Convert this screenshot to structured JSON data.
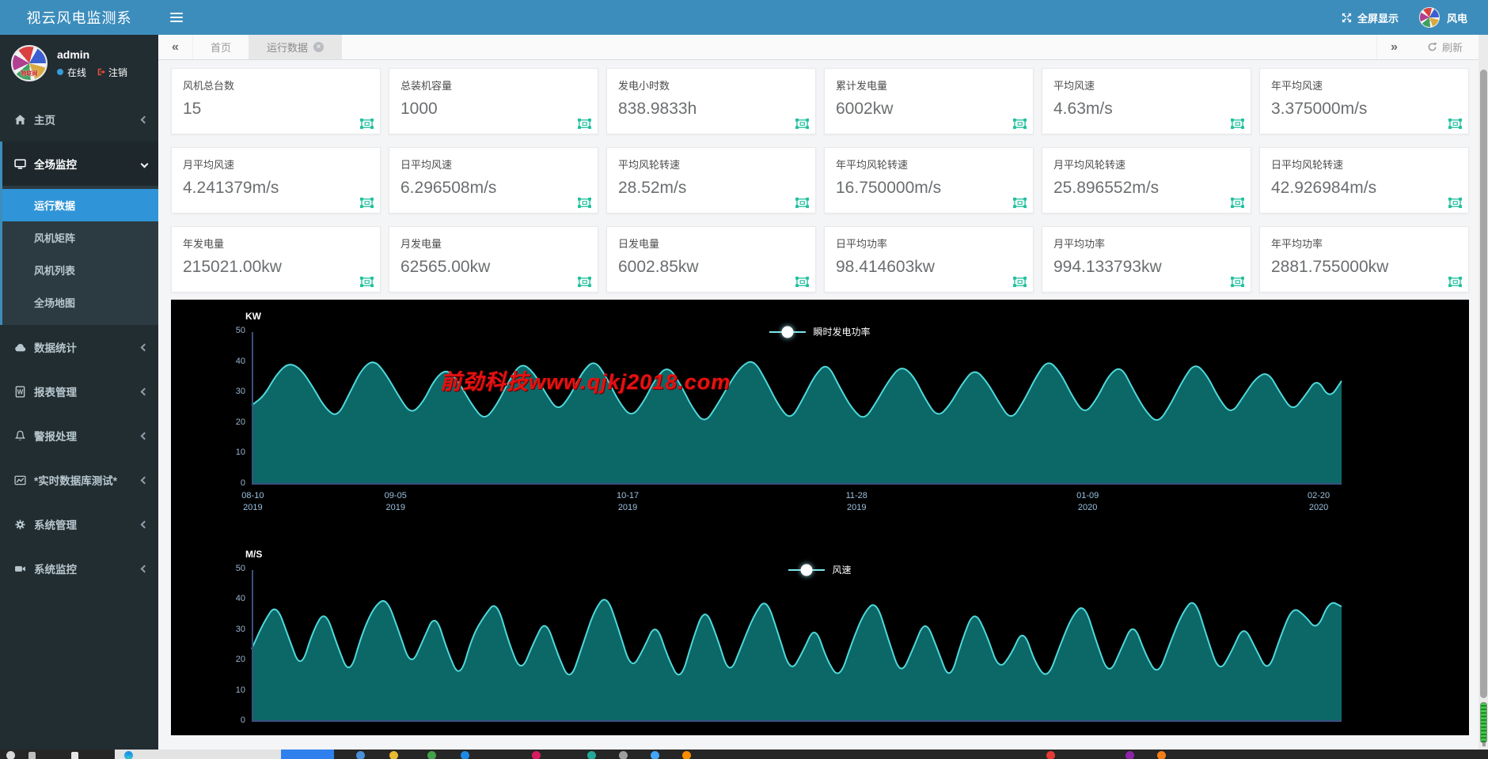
{
  "header": {
    "app_title": "视云风电监测系",
    "fullscreen_label": "全屏显示",
    "username": "风电"
  },
  "sidebar": {
    "user": {
      "name": "admin",
      "status": "在线",
      "logout": "注销",
      "avatar_text": "物联网"
    },
    "home": {
      "label": "主页",
      "icon": "home-icon"
    },
    "monitor_group": {
      "label": "全场监控",
      "icon": "monitor-icon"
    },
    "submenu": [
      {
        "label": "运行数据",
        "active": true
      },
      {
        "label": "风机矩阵"
      },
      {
        "label": "风机列表"
      },
      {
        "label": "全场地图"
      }
    ],
    "items": [
      {
        "label": "数据统计",
        "icon": "cloud-icon"
      },
      {
        "label": "报表管理",
        "icon": "report-icon"
      },
      {
        "label": "警报处理",
        "icon": "bell-icon"
      },
      {
        "label": "*实时数据库测试*",
        "icon": "chart-line-icon"
      },
      {
        "label": "系统管理",
        "icon": "gear-icon"
      },
      {
        "label": "系统监控",
        "icon": "camera-icon"
      }
    ]
  },
  "tabbar": {
    "tabs": [
      {
        "label": "首页"
      },
      {
        "label": "运行数据",
        "active": true,
        "closable": true
      }
    ],
    "refresh_label": "刷新"
  },
  "cards": [
    {
      "label": "风机总台数",
      "value": "15"
    },
    {
      "label": "总装机容量",
      "value": "1000"
    },
    {
      "label": "发电小时数",
      "value": "838.9833h"
    },
    {
      "label": "累计发电量",
      "value": "6002kw"
    },
    {
      "label": "平均风速",
      "value": "4.63m/s"
    },
    {
      "label": "年平均风速",
      "value": "3.375000m/s"
    },
    {
      "label": "月平均风速",
      "value": "4.241379m/s"
    },
    {
      "label": "日平均风速",
      "value": "6.296508m/s"
    },
    {
      "label": "平均风轮转速",
      "value": "28.52m/s"
    },
    {
      "label": "年平均风轮转速",
      "value": "16.750000m/s"
    },
    {
      "label": "月平均风轮转速",
      "value": "25.896552m/s"
    },
    {
      "label": "日平均风轮转速",
      "value": "42.926984m/s"
    },
    {
      "label": "年发电量",
      "value": "215021.00kw"
    },
    {
      "label": "月发电量",
      "value": "62565.00kw"
    },
    {
      "label": "日发电量",
      "value": "6002.85kw"
    },
    {
      "label": "日平均功率",
      "value": "98.414603kw"
    },
    {
      "label": "月平均功率",
      "value": "994.133793kw"
    },
    {
      "label": "年平均功率",
      "value": "2881.755000kw"
    }
  ],
  "watermark": "前劲科技www.qjkj2018.com",
  "colors": {
    "accent": "#3c8dbc",
    "chart_stroke": "#4fd9db",
    "chart_fill": "#0d6b6b",
    "axis": "#3a4f7e",
    "tick_text": "#9db4d0",
    "card_icon": "#1fbf9c",
    "watermark": "#e51111"
  },
  "chart_data": [
    {
      "type": "area",
      "unit": "KW",
      "legend": "瞬时发电功率",
      "ylim": [
        0,
        50
      ],
      "yticks": [
        50,
        40,
        30,
        20,
        10,
        0
      ],
      "grid": false,
      "legend_position": "top-center",
      "x_labels": [
        {
          "date": "08-10",
          "year": "2019",
          "pos": 0.001
        },
        {
          "date": "09-05",
          "year": "2019",
          "pos": 0.132
        },
        {
          "date": "10-17",
          "year": "2019",
          "pos": 0.345
        },
        {
          "date": "11-28",
          "year": "2019",
          "pos": 0.555
        },
        {
          "date": "01-09",
          "year": "2020",
          "pos": 0.767
        },
        {
          "date": "02-20",
          "year": "2020",
          "pos": 0.979
        }
      ],
      "values": [
        26,
        29,
        36,
        40,
        38,
        32,
        25,
        22,
        30,
        38,
        41,
        36,
        29,
        23,
        27,
        35,
        38,
        33,
        26,
        21,
        26,
        34,
        40,
        37,
        30,
        24,
        29,
        37,
        41,
        35,
        27,
        22,
        27,
        35,
        39,
        33,
        25,
        20,
        26,
        33,
        39,
        41,
        34,
        26,
        21,
        28,
        36,
        40,
        32,
        25,
        21,
        27,
        34,
        39,
        36,
        28,
        22,
        26,
        33,
        38,
        34,
        27,
        21,
        27,
        35,
        41,
        37,
        29,
        23,
        28,
        36,
        39,
        31,
        24,
        20,
        26,
        34,
        40,
        36,
        28,
        23,
        29,
        35,
        37,
        30,
        24,
        29,
        35,
        28,
        34
      ]
    },
    {
      "type": "area",
      "unit": "M/S",
      "legend": "风速",
      "ylim": [
        0,
        50
      ],
      "yticks": [
        50,
        40,
        30,
        20,
        10,
        0
      ],
      "grid": false,
      "legend_position": "top-center",
      "x_labels": [],
      "values": [
        24,
        33,
        39,
        28,
        17,
        30,
        37,
        25,
        15,
        29,
        38,
        41,
        30,
        18,
        27,
        36,
        23,
        14,
        28,
        35,
        40,
        26,
        16,
        26,
        34,
        22,
        13,
        25,
        37,
        42,
        30,
        17,
        24,
        33,
        21,
        13,
        27,
        38,
        28,
        15,
        25,
        35,
        41,
        29,
        16,
        23,
        32,
        20,
        14,
        26,
        36,
        40,
        27,
        15,
        24,
        34,
        24,
        13,
        27,
        37,
        29,
        17,
        22,
        31,
        19,
        14,
        25,
        35,
        39,
        26,
        15,
        24,
        33,
        22,
        15,
        26,
        36,
        41,
        28,
        16,
        23,
        32,
        24,
        16,
        28,
        38,
        35,
        30,
        40,
        38
      ]
    }
  ],
  "taskbar": {
    "icon_colors": [
      "#4a90d9",
      "#e8b931",
      "#43a047",
      "#1e88e5",
      "#d81b60",
      "#26a69a",
      "#9e9e9e",
      "#42a5f5",
      "#fb8c00",
      "#e53935",
      "#8e24aa",
      "#f57f17"
    ]
  }
}
